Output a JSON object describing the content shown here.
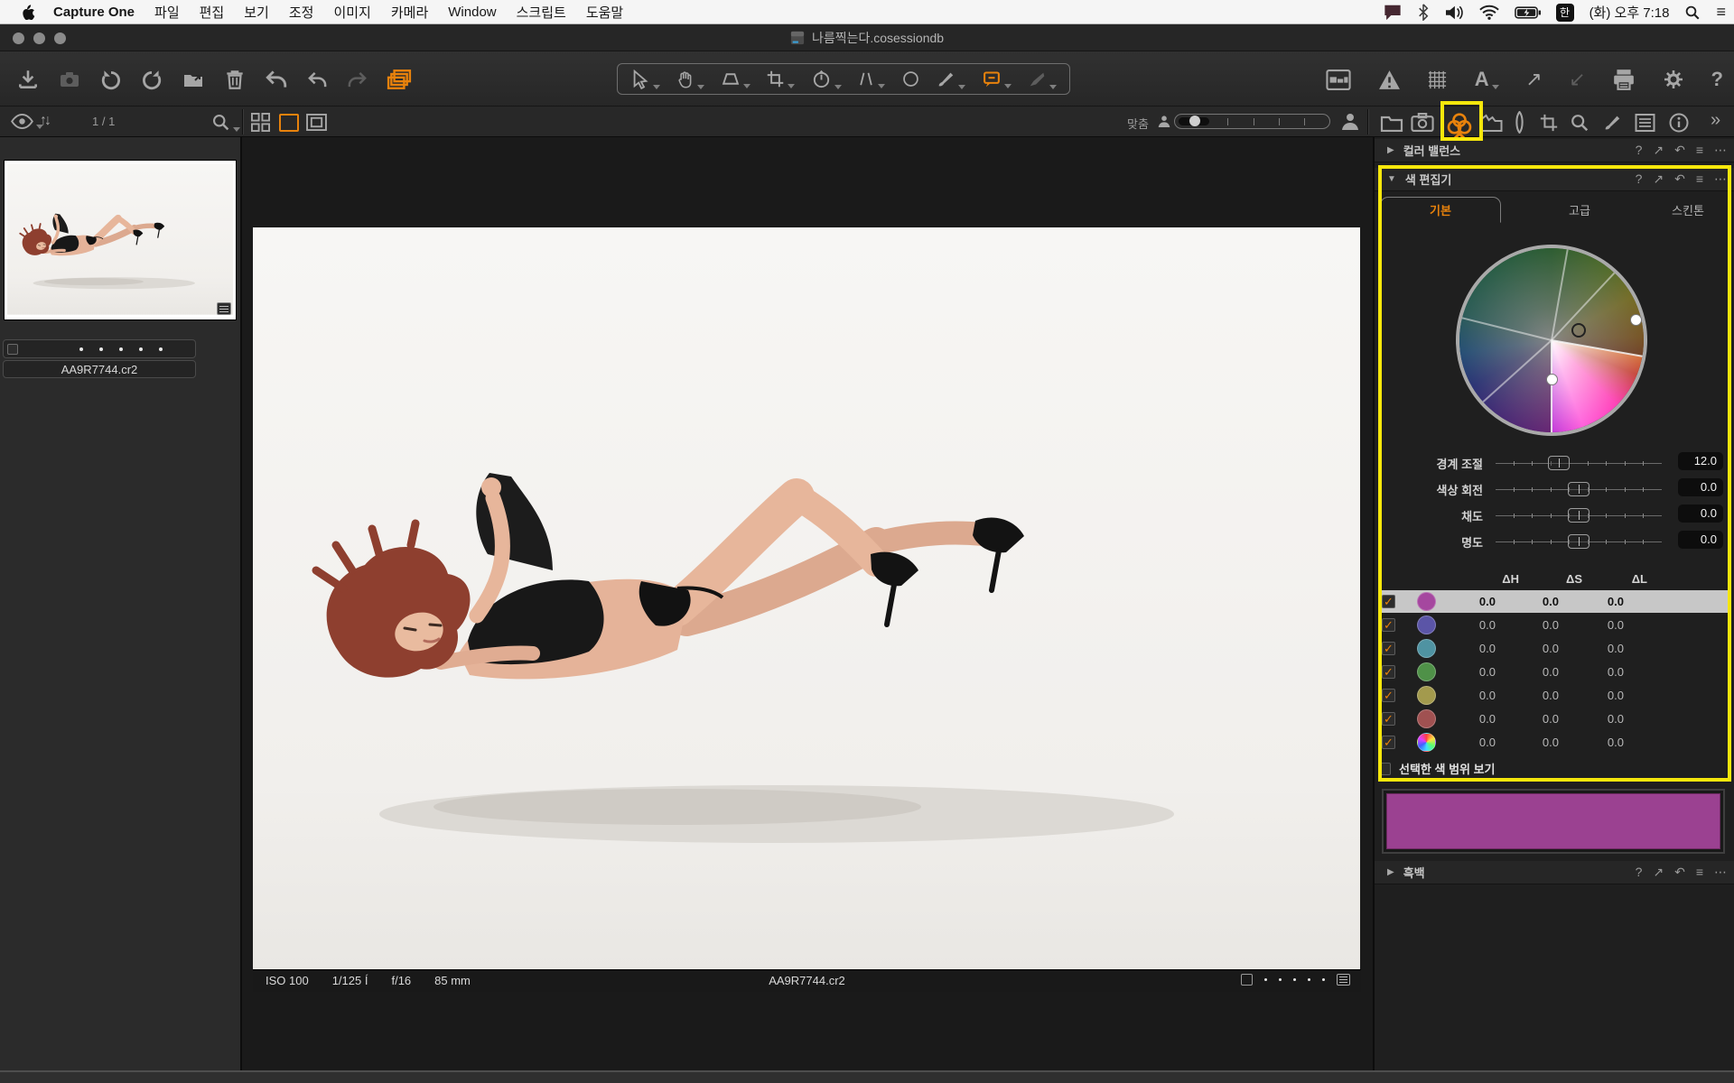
{
  "menu_bar": {
    "app_name": "Capture One",
    "items": [
      "파일",
      "편집",
      "보기",
      "조정",
      "이미지",
      "카메라",
      "Window",
      "스크립트",
      "도움말"
    ],
    "input_source": "한",
    "clock": "(화) 오후 7:18"
  },
  "window": {
    "title": "나름찍는다.cosessiondb"
  },
  "browser": {
    "count": "1 / 1",
    "filename": "AA9R7744.cr2"
  },
  "viewer": {
    "fit_label": "맞춤",
    "info_bar": {
      "iso": "ISO 100",
      "shutter": "1/125 Í",
      "aperture": "f/16",
      "focal_length": "85 mm",
      "filename": "AA9R7744.cr2"
    }
  },
  "right_panel": {
    "color_balance": {
      "title": "컬러 밸런스"
    },
    "color_editor": {
      "title": "색 편집기",
      "tabs": [
        {
          "label": "기본",
          "selected": true
        },
        {
          "label": "고급",
          "selected": false
        },
        {
          "label": "스킨톤",
          "selected": false
        }
      ],
      "sliders": [
        {
          "label": "경계 조절",
          "value": "12.0"
        },
        {
          "label": "색상 회전",
          "value": "0.0"
        },
        {
          "label": "채도",
          "value": "0.0"
        },
        {
          "label": "명도",
          "value": "0.0"
        }
      ],
      "table": {
        "headers": [
          "ΔH",
          "ΔS",
          "ΔL"
        ],
        "rows": [
          {
            "color": "#a5479f",
            "swatch_style": "background:#a5479f",
            "dh": "0.0",
            "ds": "0.0",
            "dl": "0.0",
            "checked": true,
            "selected": true
          },
          {
            "color": "#5b55a7",
            "swatch_style": "background:#5b55a7",
            "dh": "0.0",
            "ds": "0.0",
            "dl": "0.0",
            "checked": true,
            "selected": false
          },
          {
            "color": "#4f93a2",
            "swatch_style": "background:#4f93a2",
            "dh": "0.0",
            "ds": "0.0",
            "dl": "0.0",
            "checked": true,
            "selected": false
          },
          {
            "color": "#4f9148",
            "swatch_style": "background:#4f9148",
            "dh": "0.0",
            "ds": "0.0",
            "dl": "0.0",
            "checked": true,
            "selected": false
          },
          {
            "color": "#a39a4d",
            "swatch_style": "background:#a39a4d",
            "dh": "0.0",
            "ds": "0.0",
            "dl": "0.0",
            "checked": true,
            "selected": false
          },
          {
            "color": "#a05151",
            "swatch_style": "background:#a05151",
            "dh": "0.0",
            "ds": "0.0",
            "dl": "0.0",
            "checked": true,
            "selected": false
          },
          {
            "color": "rainbow",
            "swatch_style": "background:conic-gradient(#ff4040,#ffe040,#58ff70,#40e0ff,#4060ff,#e040ff,#ff4040)",
            "dh": "0.0",
            "ds": "0.0",
            "dl": "0.0",
            "checked": true,
            "selected": false
          }
        ]
      },
      "range_toggle_label": "선택한 색 범위 보기",
      "selected_color_swatch": "#9b4191",
      "swatch_style": "background:#9b4191"
    },
    "black_white": {
      "title": "흑백"
    }
  },
  "glyphs": {
    "help": "?",
    "apply": "↗",
    "reset": "↶",
    "menu": "≡",
    "more": "⋯",
    "collapse_open": "▼",
    "collapse_closed": "▶",
    "check": "✓",
    "sort": "↑↓",
    "letter_a": "A",
    "arrow_up_right": "↗",
    "arrow_down_left": "↙",
    "question": "?",
    "chevron_overflow": "»"
  },
  "annotation": {
    "highlight_color": "#f6e70b"
  }
}
